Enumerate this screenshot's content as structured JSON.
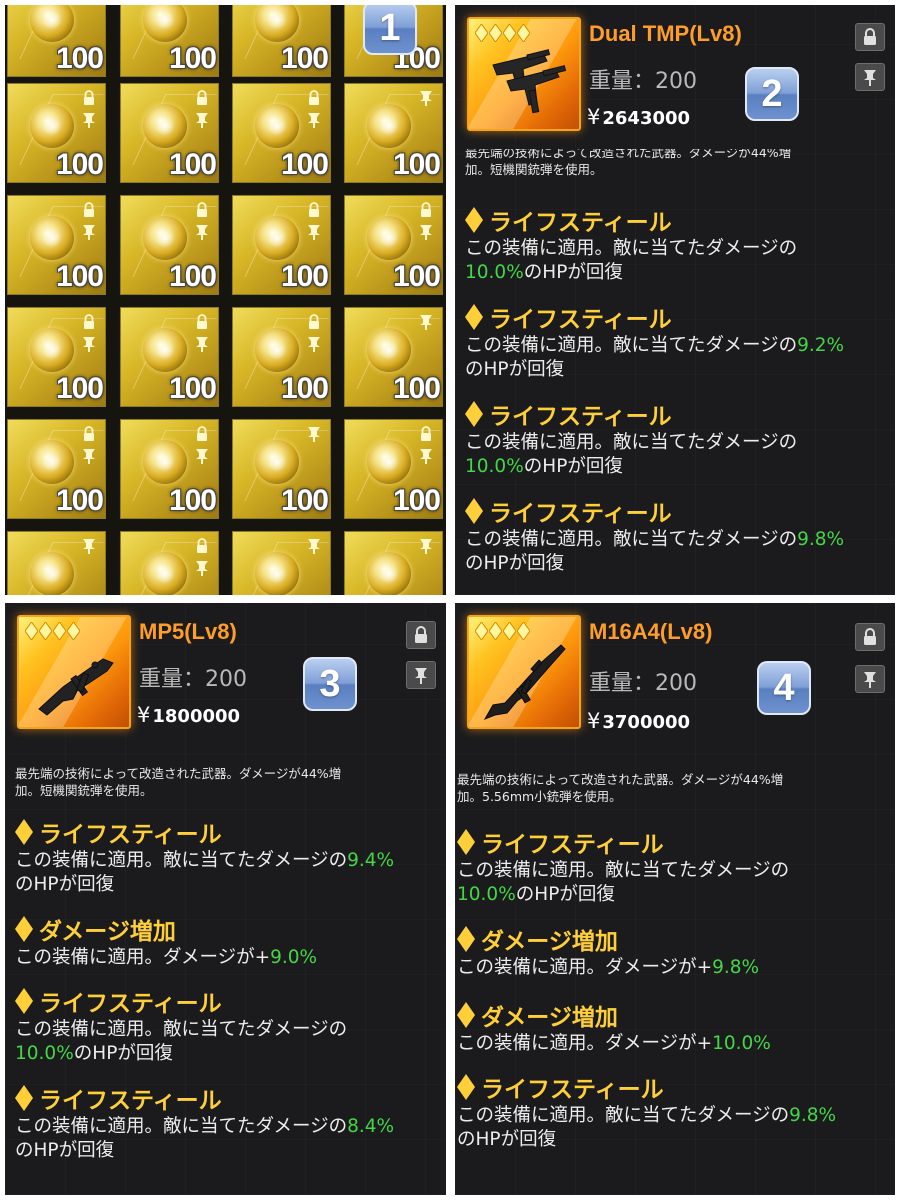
{
  "panel1": {
    "badge": "1",
    "tile_count": "100",
    "tiles": [
      {
        "row": 0,
        "col": 0,
        "lock": false,
        "pin": true
      },
      {
        "row": 0,
        "col": 1,
        "lock": false,
        "pin": true
      },
      {
        "row": 0,
        "col": 2,
        "lock": false,
        "pin": true
      },
      {
        "row": 0,
        "col": 3,
        "lock": false,
        "pin": true
      },
      {
        "row": 1,
        "col": 0,
        "lock": true,
        "pin": true
      },
      {
        "row": 1,
        "col": 1,
        "lock": true,
        "pin": true
      },
      {
        "row": 1,
        "col": 2,
        "lock": true,
        "pin": true
      },
      {
        "row": 1,
        "col": 3,
        "lock": false,
        "pin": true
      },
      {
        "row": 2,
        "col": 0,
        "lock": true,
        "pin": true
      },
      {
        "row": 2,
        "col": 1,
        "lock": true,
        "pin": true
      },
      {
        "row": 2,
        "col": 2,
        "lock": true,
        "pin": true
      },
      {
        "row": 2,
        "col": 3,
        "lock": true,
        "pin": true
      },
      {
        "row": 3,
        "col": 0,
        "lock": true,
        "pin": true
      },
      {
        "row": 3,
        "col": 1,
        "lock": true,
        "pin": true
      },
      {
        "row": 3,
        "col": 2,
        "lock": true,
        "pin": true
      },
      {
        "row": 3,
        "col": 3,
        "lock": false,
        "pin": true
      },
      {
        "row": 4,
        "col": 0,
        "lock": true,
        "pin": true
      },
      {
        "row": 4,
        "col": 1,
        "lock": true,
        "pin": true
      },
      {
        "row": 4,
        "col": 2,
        "lock": false,
        "pin": true
      },
      {
        "row": 4,
        "col": 3,
        "lock": true,
        "pin": true
      },
      {
        "row": 5,
        "col": 0,
        "lock": false,
        "pin": true
      },
      {
        "row": 5,
        "col": 1,
        "lock": true,
        "pin": true
      },
      {
        "row": 5,
        "col": 2,
        "lock": false,
        "pin": true
      },
      {
        "row": 5,
        "col": 3,
        "lock": false,
        "pin": true
      }
    ]
  },
  "panel2": {
    "badge": "2",
    "name": "Dual TMP(Lv8)",
    "weight": "重量：200",
    "price_symbol": "¥",
    "price": "2643000",
    "desc_line1": "最先端の技術によって改造された武器。ダメージが44%増",
    "desc_line2": "加。短機関銃弾を使用。",
    "skills": [
      {
        "name": "ライフスティール",
        "text_a": "この装備に適用。敵に当てたダメージの",
        "value": "10.0%",
        "text_b": "のHPが回復"
      },
      {
        "name": "ライフスティール",
        "text_a": "この装備に適用。敵に当てたダメージの",
        "value": "9.2%",
        "text_b": "のHPが回復"
      },
      {
        "name": "ライフスティール",
        "text_a": "この装備に適用。敵に当てたダメージの",
        "value": "10.0%",
        "text_b": "のHPが回復"
      },
      {
        "name": "ライフスティール",
        "text_a": "この装備に適用。敵に当てたダメージの",
        "value": "9.8%",
        "text_b": "のHPが回復"
      }
    ]
  },
  "panel3": {
    "badge": "3",
    "name": "MP5(Lv8)",
    "weight": "重量：200",
    "price_symbol": "¥",
    "price": "1800000",
    "desc_line1": "最先端の技術によって改造された武器。ダメージが44%増",
    "desc_line2": "加。短機関銃弾を使用。",
    "skills": [
      {
        "name": "ライフスティール",
        "text_a": "この装備に適用。敵に当てたダメージの",
        "value": "9.4%",
        "text_b": "のHPが回復"
      },
      {
        "name": "ダメージ増加",
        "text_a": "この装備に適用。ダメージが+",
        "value": "9.0%",
        "text_b": ""
      },
      {
        "name": "ライフスティール",
        "text_a": "この装備に適用。敵に当てたダメージの",
        "value": "10.0%",
        "text_b": "のHPが回復"
      },
      {
        "name": "ライフスティール",
        "text_a": "この装備に適用。敵に当てたダメージの",
        "value": "8.4%",
        "text_b": "のHPが回復"
      }
    ]
  },
  "panel4": {
    "badge": "4",
    "name": "M16A4(Lv8)",
    "weight": "重量：200",
    "price_symbol": "¥",
    "price": "3700000",
    "desc_line1": "最先端の技術によって改造された武器。ダメージが44%増",
    "desc_line2": "加。5.56mm小銃弾を使用。",
    "skills": [
      {
        "name": "ライフスティール",
        "text_a": "この装備に適用。敵に当てたダメージの",
        "value": "10.0%",
        "text_b": "のHPが回復"
      },
      {
        "name": "ダメージ増加",
        "text_a": "この装備に適用。ダメージが+",
        "value": "9.8%",
        "text_b": ""
      },
      {
        "name": "ダメージ増加",
        "text_a": "この装備に適用。ダメージが+",
        "value": "10.0%",
        "text_b": ""
      },
      {
        "name": "ライフスティール",
        "text_a": "この装備に適用。敵に当てたダメージの",
        "value": "9.8%",
        "text_b": "のHPが回復"
      }
    ]
  },
  "colors": {
    "item_name": "#ff9d2a",
    "skill_name": "#ffcf3a",
    "value_highlight": "#43d646",
    "rarity_frame": "#f6a21a"
  },
  "icons": {
    "rarity": "diamond-icon",
    "lock": "lock-icon",
    "pin": "pin-icon",
    "weapon": "weapon-icon"
  }
}
